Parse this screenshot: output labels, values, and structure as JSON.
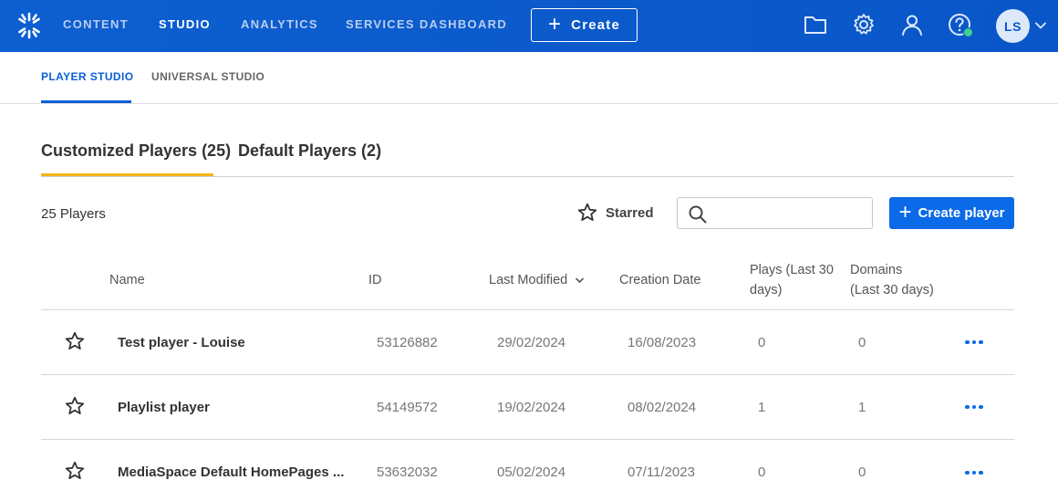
{
  "nav": {
    "items": [
      {
        "label": "CONTENT",
        "active": false
      },
      {
        "label": "STUDIO",
        "active": true
      },
      {
        "label": "ANALYTICS",
        "active": false
      },
      {
        "label": "SERVICES DASHBOARD",
        "active": false
      }
    ],
    "create_label": "Create",
    "icons": [
      "folder-icon",
      "gear-icon",
      "user-icon",
      "help-icon"
    ],
    "avatar_initials": "LS",
    "accent": "#0a5fd6",
    "status_color": "#3ed18b"
  },
  "subnav": {
    "tabs": [
      {
        "label": "PLAYER STUDIO",
        "active": true
      },
      {
        "label": "UNIVERSAL STUDIO",
        "active": false
      }
    ]
  },
  "player_tabs": [
    {
      "label": "Customized Players (25)",
      "active": true
    },
    {
      "label": "Default Players (2)",
      "active": false
    }
  ],
  "toolbar": {
    "count": "25 Players",
    "starred_label": "Starred",
    "search_placeholder": "",
    "create_player_label": "Create player"
  },
  "table": {
    "columns": {
      "name": "Name",
      "id": "ID",
      "last_modified": "Last Modified",
      "creation_date": "Creation Date",
      "plays_line1": "Plays (Last 30",
      "plays_line2": "days)",
      "domains_line1": "Domains",
      "domains_line2": "(Last 30 days)"
    },
    "sort": {
      "column": "last_modified",
      "direction": "descending"
    },
    "rows": [
      {
        "name": "Test player - Louise",
        "id": "53126882",
        "last_modified": "29/02/2024",
        "creation_date": "16/08/2023",
        "plays": "0",
        "domains": "0",
        "starred": false
      },
      {
        "name": "Playlist player",
        "id": "54149572",
        "last_modified": "19/02/2024",
        "creation_date": "08/02/2024",
        "plays": "1",
        "domains": "1",
        "starred": false
      },
      {
        "name": "MediaSpace Default HomePages ...",
        "id": "53632032",
        "last_modified": "05/02/2024",
        "creation_date": "07/11/2023",
        "plays": "0",
        "domains": "0",
        "starred": false
      }
    ]
  }
}
